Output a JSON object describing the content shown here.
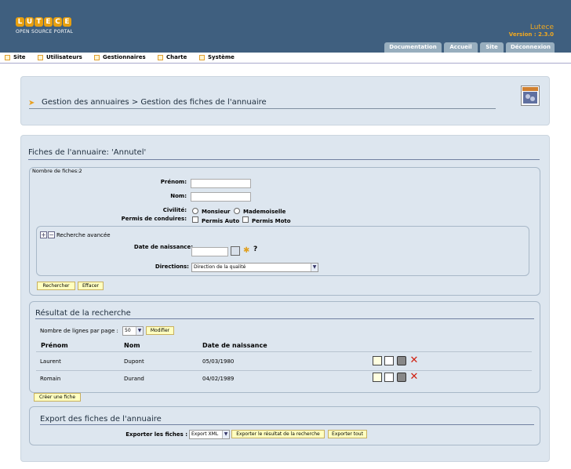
{
  "header": {
    "logo_letters": [
      "L",
      "U",
      "T",
      "E",
      "C",
      "E"
    ],
    "logo_subtitle": "OPEN SOURCE PORTAL",
    "app_name": "Lutece",
    "app_version": "Version : 2.3.0",
    "tabs": [
      {
        "label": "Documentation"
      },
      {
        "label": "Accueil"
      },
      {
        "label": "Site"
      },
      {
        "label": "Déconnexion"
      }
    ]
  },
  "menu": {
    "items": [
      {
        "label": "Site"
      },
      {
        "label": "Utilisateurs"
      },
      {
        "label": "Gestionnaires"
      },
      {
        "label": "Charte"
      },
      {
        "label": "Système"
      }
    ]
  },
  "breadcrumb": {
    "text": "Gestion des annuaires  > Gestion des fiches de l'annuaire"
  },
  "search": {
    "title": "Fiches de l'annuaire: 'Annutel'",
    "count_label": "Nombre de fiches:2",
    "prenom_label": "Prénom:",
    "nom_label": "Nom:",
    "civilite_label": "Civilité:",
    "civilite_options": [
      "Monsieur",
      "Mademoiselle"
    ],
    "permis_label": "Permis de conduires:",
    "permis_options": [
      "Permis Auto",
      "Permis Moto"
    ],
    "advanced_label": "Recherche avancée",
    "birth_label": "Date de naissance:",
    "help_mark": "?",
    "directions_label": "Directions:",
    "directions_value": "Direction de la qualité",
    "search_button": "Rechercher",
    "clear_button": "Effacer"
  },
  "results": {
    "title": "Résultat de la recherche",
    "rows_per_page_label": "Nombre de lignes par page :",
    "rows_per_page_value": "50",
    "modify_button": "Modifier",
    "columns": [
      "Prénom",
      "Nom",
      "Date de naissance"
    ],
    "rows": [
      {
        "prenom": "Laurent",
        "nom": "Dupont",
        "date": "05/03/1980"
      },
      {
        "prenom": "Romain",
        "nom": "Durand",
        "date": "04/02/1989"
      }
    ],
    "create_button": "Créer une fiche"
  },
  "export": {
    "title": "Export des fiches de l'annuaire",
    "label": "Exporter les fiches :",
    "format_value": "Export XML",
    "export_result_button": "Exporter le résultat de la recherche",
    "export_all_button": "Exporter tout"
  },
  "colors": {
    "header_bg": "#3f5f7f",
    "accent": "#f0a820",
    "panel_bg": "#dde6ef",
    "tab_bg": "#98aebe"
  }
}
